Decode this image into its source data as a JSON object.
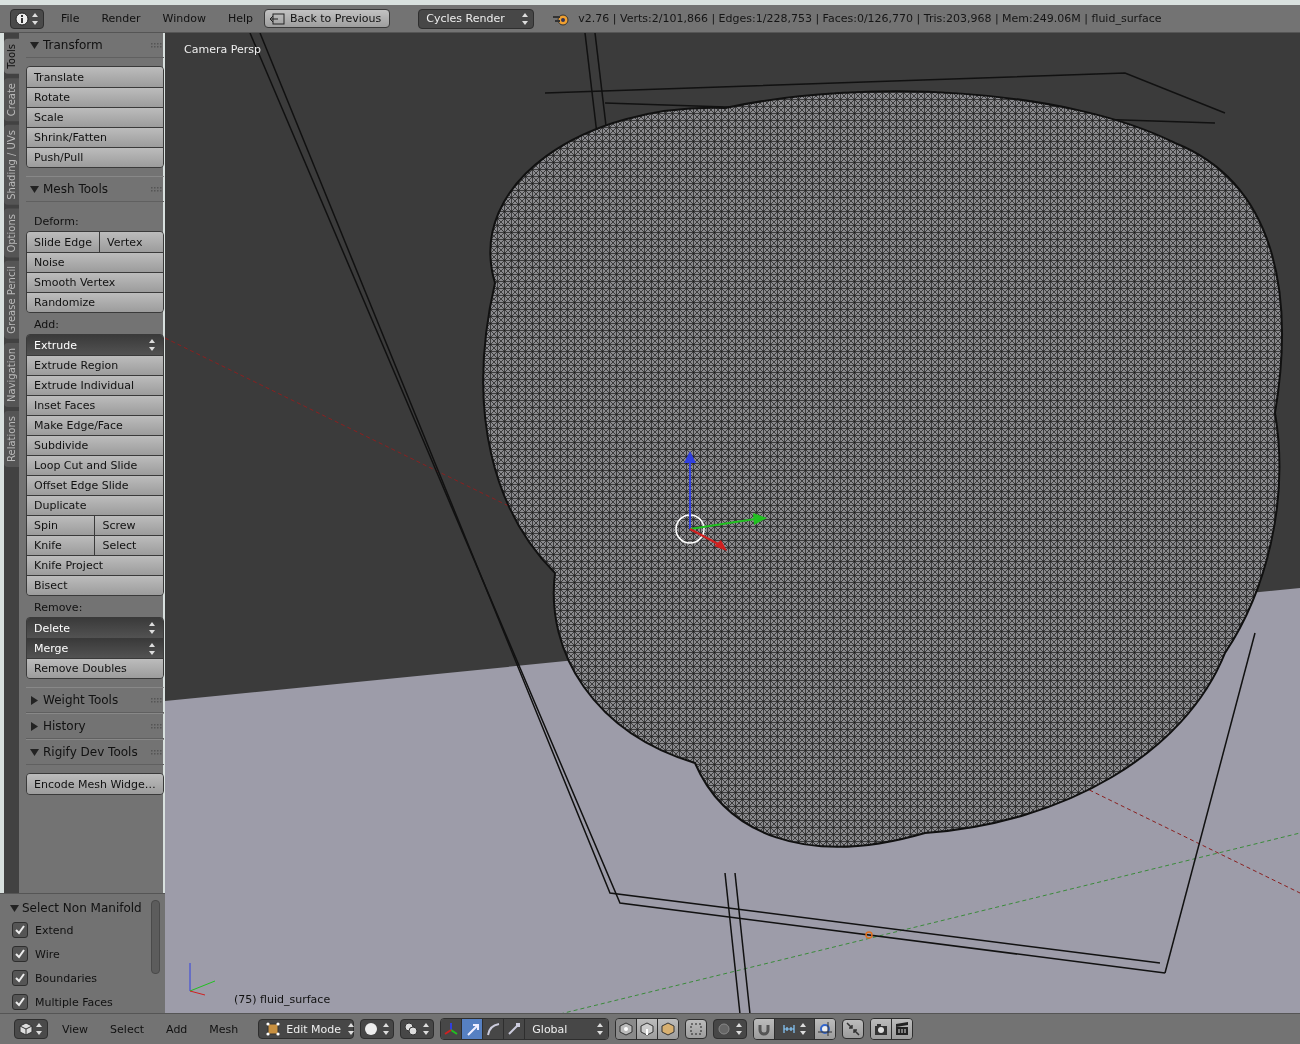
{
  "header": {
    "menus": [
      "File",
      "Render",
      "Window",
      "Help"
    ],
    "back_button": "Back to Previous",
    "render_engine": "Cycles Render",
    "stats": "v2.76 | Verts:2/101,866 | Edges:1/228,753 | Faces:0/126,770 | Tris:203,968 | Mem:249.06M | fluid_surface"
  },
  "tool_tabs": [
    {
      "label": "Tools",
      "selected": true
    },
    {
      "label": "Create",
      "selected": false
    },
    {
      "label": "Shading / UVs",
      "selected": false
    },
    {
      "label": "Options",
      "selected": false
    },
    {
      "label": "Grease Pencil",
      "selected": false
    },
    {
      "label": "Navigation",
      "selected": false
    },
    {
      "label": "Relations",
      "selected": false
    }
  ],
  "panels": [
    {
      "title": "Transform",
      "expanded": true,
      "sections": [
        {
          "items": [
            {
              "kind": "button",
              "text": "Translate"
            },
            {
              "kind": "button",
              "text": "Rotate"
            },
            {
              "kind": "button",
              "text": "Scale"
            },
            {
              "kind": "button",
              "text": "Shrink/Fatten"
            },
            {
              "kind": "button",
              "text": "Push/Pull"
            }
          ]
        }
      ]
    },
    {
      "title": "Mesh Tools",
      "expanded": true,
      "sections": [
        {
          "label": "Deform:",
          "items": [
            {
              "kind": "split",
              "texts": [
                "Slide Edge",
                "Vertex"
              ]
            },
            {
              "kind": "button",
              "text": "Noise"
            },
            {
              "kind": "button",
              "text": "Smooth Vertex"
            },
            {
              "kind": "button",
              "text": "Randomize"
            }
          ]
        },
        {
          "label": "Add:",
          "items": [
            {
              "kind": "dropdown",
              "text": "Extrude"
            },
            {
              "kind": "button",
              "text": "Extrude Region"
            },
            {
              "kind": "button",
              "text": "Extrude Individual"
            },
            {
              "kind": "button",
              "text": "Inset Faces"
            },
            {
              "kind": "button",
              "text": "Make Edge/Face"
            },
            {
              "kind": "button",
              "text": "Subdivide"
            },
            {
              "kind": "button",
              "text": "Loop Cut and Slide"
            },
            {
              "kind": "button",
              "text": "Offset Edge Slide"
            },
            {
              "kind": "button",
              "text": "Duplicate"
            },
            {
              "kind": "split",
              "texts": [
                "Spin",
                "Screw"
              ]
            },
            {
              "kind": "split",
              "texts": [
                "Knife",
                "Select"
              ]
            },
            {
              "kind": "button",
              "text": "Knife Project"
            },
            {
              "kind": "button",
              "text": "Bisect"
            }
          ]
        },
        {
          "label": "Remove:",
          "items": [
            {
              "kind": "dropdown",
              "text": "Delete"
            },
            {
              "kind": "dropdown",
              "text": "Merge"
            },
            {
              "kind": "button",
              "text": "Remove Doubles"
            }
          ]
        }
      ]
    },
    {
      "title": "Weight Tools",
      "expanded": false
    },
    {
      "title": "History",
      "expanded": false
    },
    {
      "title": "Rigify Dev Tools",
      "expanded": true,
      "sections": [
        {
          "items": [
            {
              "kind": "button",
              "text": "Encode Mesh Widge…"
            }
          ]
        }
      ]
    }
  ],
  "operator_panel": {
    "title": "Select Non Manifold",
    "options": [
      {
        "label": "Extend",
        "checked": true
      },
      {
        "label": "Wire",
        "checked": true
      },
      {
        "label": "Boundaries",
        "checked": true
      },
      {
        "label": "Multiple Faces",
        "checked": true
      }
    ]
  },
  "viewport": {
    "view_name": "Camera Persp",
    "object_info": "(75) fluid_surface"
  },
  "footer": {
    "menus": [
      "View",
      "Select",
      "Add",
      "Mesh"
    ],
    "mode": "Edit Mode",
    "manipulators": [
      {
        "kind": "translate",
        "selected": true
      },
      {
        "kind": "rotate",
        "selected": false
      },
      {
        "kind": "scale",
        "selected": false
      }
    ],
    "orientation": "Global",
    "select_modes": [
      {
        "kind": "vertex",
        "selected": true
      },
      {
        "kind": "edge",
        "selected": false
      },
      {
        "kind": "face",
        "selected": false
      }
    ]
  }
}
